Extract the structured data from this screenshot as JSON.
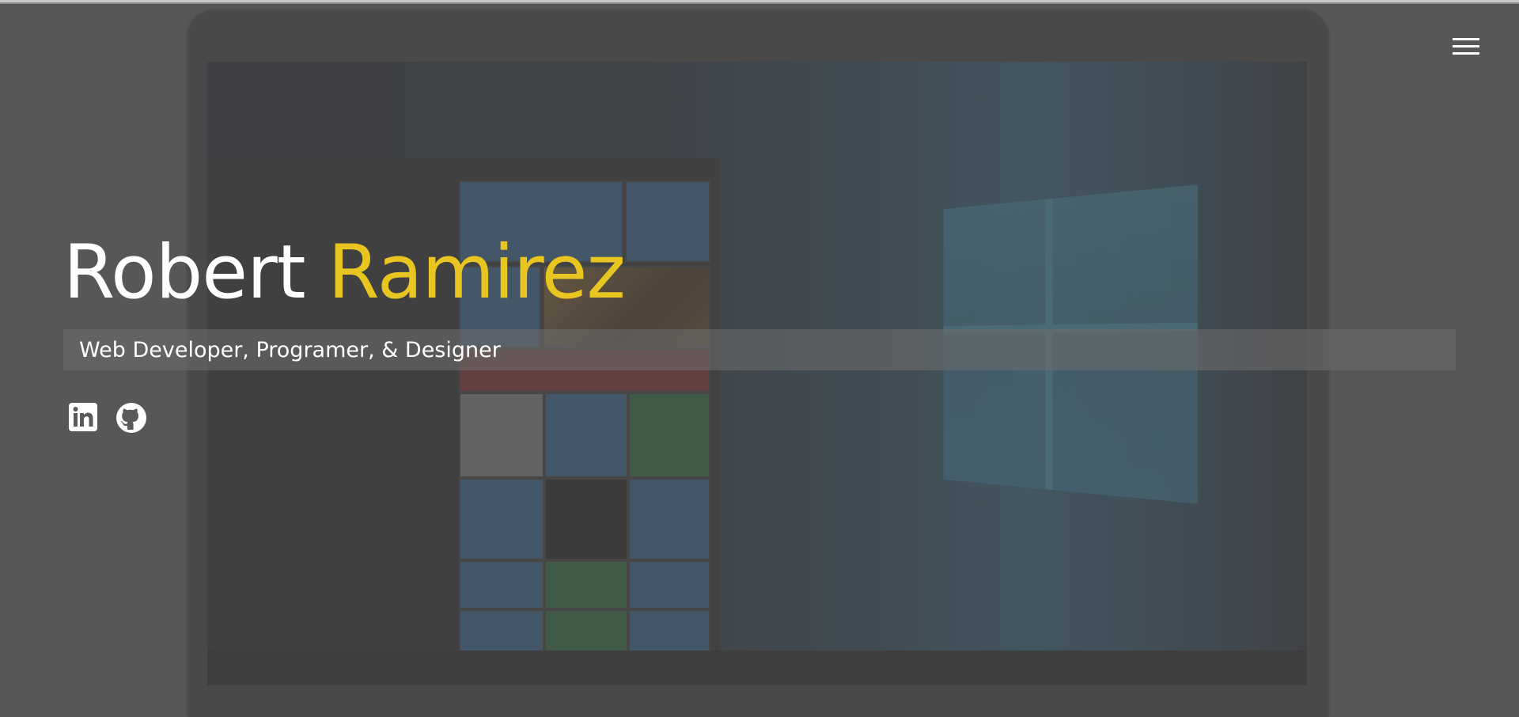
{
  "hero": {
    "first_name": "Robert",
    "last_name": "Ramirez",
    "subtitle": "Web Developer, Programer, & Designer",
    "accent_color": "#e8c520"
  },
  "nav": {
    "menu_icon": "hamburger-menu-icon"
  },
  "socials": [
    {
      "icon": "linkedin-icon"
    },
    {
      "icon": "github-icon"
    }
  ]
}
